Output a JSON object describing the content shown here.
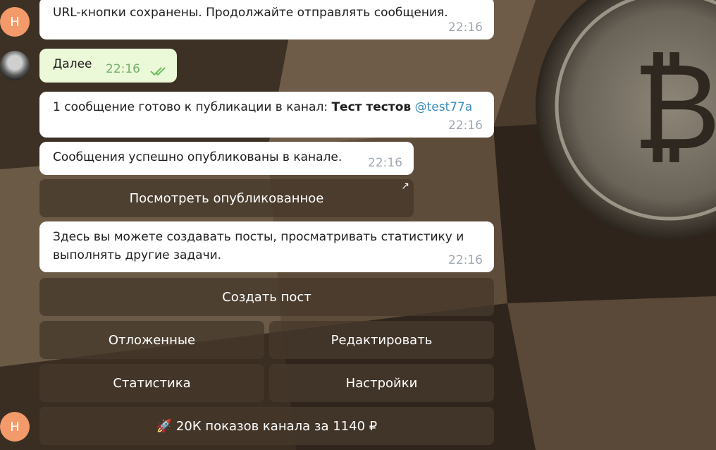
{
  "chat": {
    "avatars": {
      "bot_letter": "Н",
      "bot_letter_bottom": "Н"
    },
    "messages": [
      {
        "text": "URL-кнопки сохранены. Продолжайте отправлять сообщения.",
        "time": "22:16"
      },
      {
        "text": "Далее",
        "time": "22:16"
      },
      {
        "text_prefix": "1 сообщение готово к публикации в канал: ",
        "channel_name": "Тест тестов",
        "channel_handle": "@test77a",
        "time": "22:16"
      },
      {
        "text": "Сообщения успешно опубликованы в канале.",
        "time": "22:16"
      },
      {
        "text_line1": "Здесь вы можете создавать посты, просматривать статистику и",
        "text_line2": "выполнять другие задачи.",
        "time": "22:16"
      }
    ],
    "buttons": {
      "view_published": "Посмотреть опубликованное",
      "create_post": "Создать пост",
      "scheduled": "Отложенные",
      "edit": "Редактировать",
      "statistics": "Статистика",
      "settings": "Настройки",
      "promo": "🚀 20К показов канала за 1140 ₽"
    }
  },
  "colors": {
    "avatar_letter_bg": "#f39a6a",
    "outgoing_bubble": "#ecf9d9",
    "mention": "#3a8bbd",
    "inline_button_bg": "#46382c"
  },
  "icons": [
    "double-check-icon",
    "external-link-arrow-icon"
  ]
}
